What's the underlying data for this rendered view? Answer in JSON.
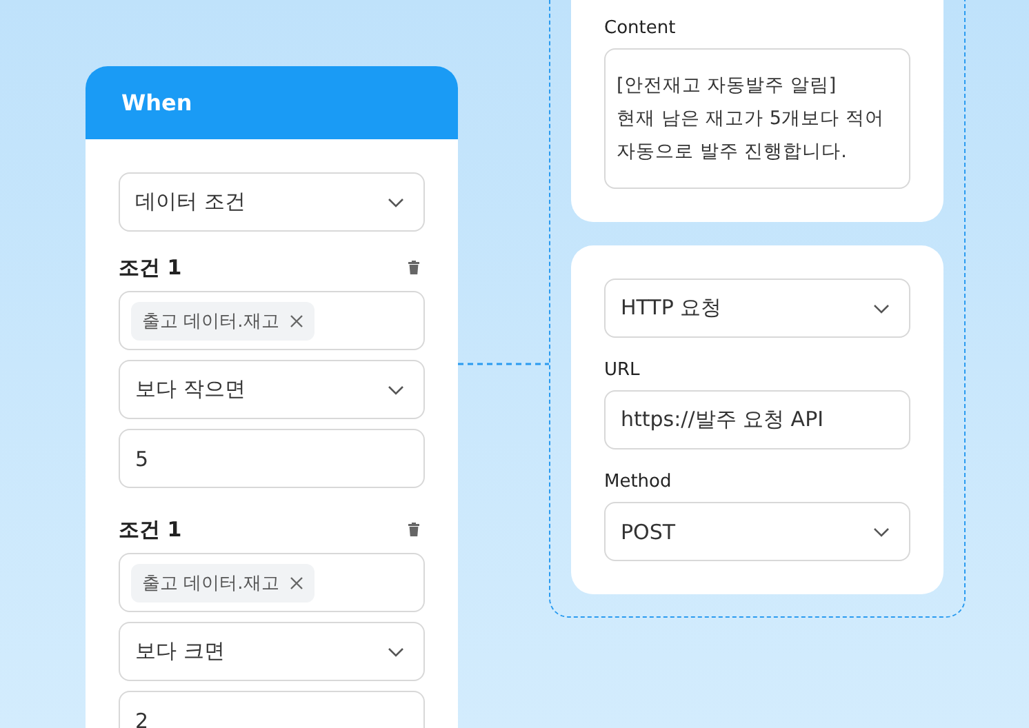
{
  "when_card": {
    "title": "When",
    "trigger": {
      "kind": "select",
      "value": "데이터 조건"
    },
    "conditions": [
      {
        "label": "조건 1",
        "fields": [
          {
            "kind": "chip",
            "value": "출고 데이터.재고"
          },
          {
            "kind": "select",
            "value": "보다 작으면"
          },
          {
            "kind": "input",
            "value": "5"
          }
        ]
      },
      {
        "label": "조건 1",
        "fields": [
          {
            "kind": "chip",
            "value": "출고 데이터.재고"
          },
          {
            "kind": "select",
            "value": "보다 크면"
          },
          {
            "kind": "input",
            "value": "2"
          }
        ]
      }
    ]
  },
  "action_cards": [
    {
      "fields": [
        {
          "label": "Content",
          "kind": "textarea",
          "value": "[안전재고 자동발주 알림]\n현재 남은 재고가 5개보다 적어\n자동으로 발주 진행합니다."
        }
      ]
    },
    {
      "fields": [
        {
          "kind": "select",
          "value": "HTTP 요청"
        },
        {
          "label": "URL",
          "kind": "input",
          "value": "https://발주 요청 API"
        },
        {
          "label": "Method",
          "kind": "select",
          "value": "POST"
        }
      ]
    }
  ]
}
